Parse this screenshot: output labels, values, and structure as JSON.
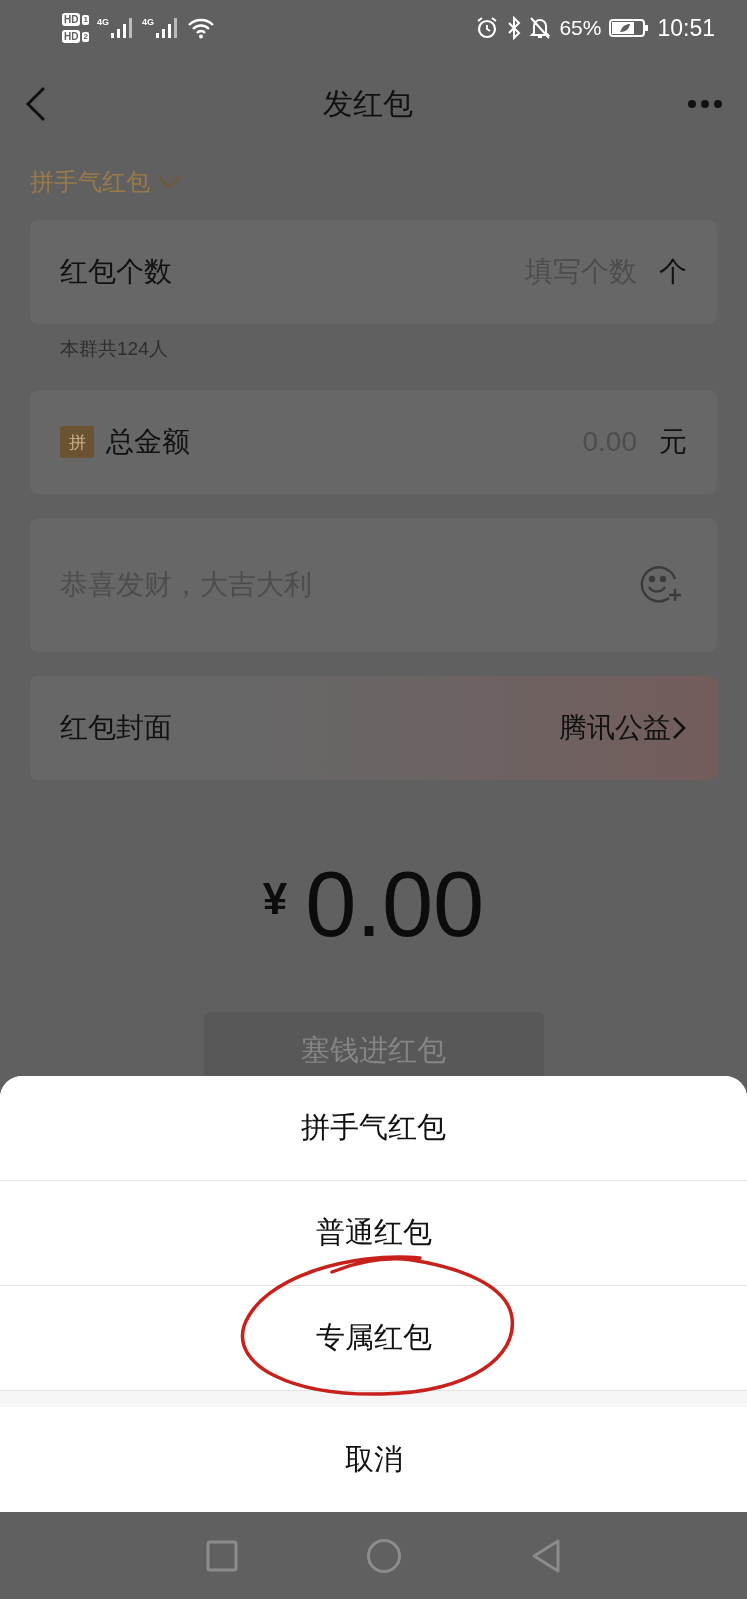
{
  "status_bar": {
    "sims": [
      {
        "label": "HD",
        "slot": "1"
      },
      {
        "label": "HD",
        "slot": "2"
      }
    ],
    "networks": [
      "4G",
      "4G"
    ],
    "battery": "65%",
    "time": "10:51"
  },
  "header": {
    "title": "发红包"
  },
  "mode_selector": {
    "label": "拼手气红包"
  },
  "count_field": {
    "label": "红包个数",
    "placeholder": "填写个数",
    "unit": "个",
    "note": "本群共124人"
  },
  "amount_field": {
    "badge": "拼",
    "label": "总金额",
    "placeholder": "0.00",
    "unit": "元"
  },
  "message_field": {
    "placeholder": "恭喜发财，大吉大利"
  },
  "cover_row": {
    "label": "红包封面",
    "value": "腾讯公益"
  },
  "total": {
    "currency": "¥",
    "amount": "0.00"
  },
  "submit_button": {
    "label": "塞钱进红包",
    "disabled": true
  },
  "action_sheet": {
    "options": [
      {
        "label": "拼手气红包",
        "circled": false
      },
      {
        "label": "普通红包",
        "circled": false
      },
      {
        "label": "专属红包",
        "circled": true
      }
    ],
    "cancel": "取消"
  }
}
